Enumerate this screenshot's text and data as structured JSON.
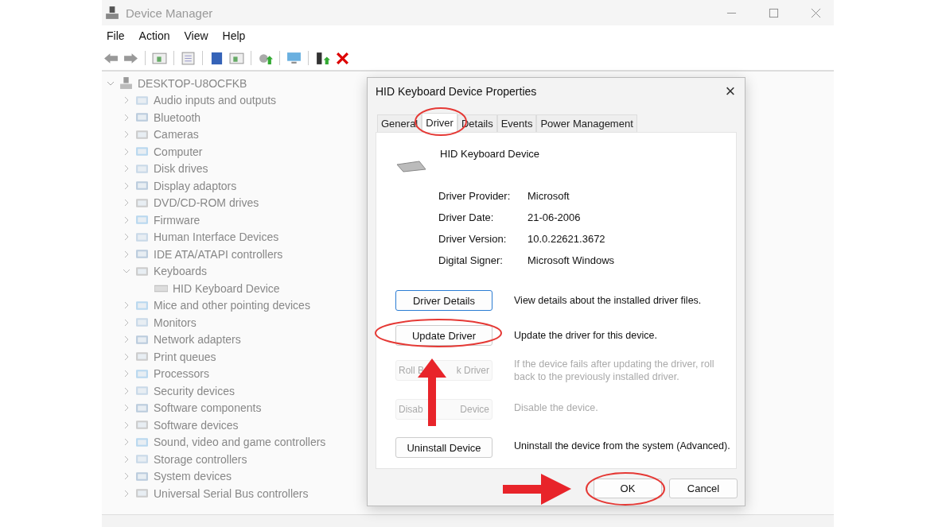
{
  "window": {
    "title": "Device Manager"
  },
  "menu": [
    "File",
    "Action",
    "View",
    "Help"
  ],
  "tree": {
    "root": "DESKTOP-U8OCFKB",
    "expanded": true,
    "children": [
      {
        "label": "Audio inputs and outputs",
        "expanded": false
      },
      {
        "label": "Bluetooth",
        "expanded": false
      },
      {
        "label": "Cameras",
        "expanded": false
      },
      {
        "label": "Computer",
        "expanded": false
      },
      {
        "label": "Disk drives",
        "expanded": false
      },
      {
        "label": "Display adaptors",
        "expanded": false
      },
      {
        "label": "DVD/CD-ROM drives",
        "expanded": false
      },
      {
        "label": "Firmware",
        "expanded": false
      },
      {
        "label": "Human Interface Devices",
        "expanded": false
      },
      {
        "label": "IDE ATA/ATAPI controllers",
        "expanded": false
      },
      {
        "label": "Keyboards",
        "expanded": true,
        "children": [
          {
            "label": "HID Keyboard Device"
          }
        ]
      },
      {
        "label": "Mice and other pointing devices",
        "expanded": false
      },
      {
        "label": "Monitors",
        "expanded": false
      },
      {
        "label": "Network adapters",
        "expanded": false
      },
      {
        "label": "Print queues",
        "expanded": false
      },
      {
        "label": "Processors",
        "expanded": false
      },
      {
        "label": "Security devices",
        "expanded": false
      },
      {
        "label": "Software components",
        "expanded": false
      },
      {
        "label": "Software devices",
        "expanded": false
      },
      {
        "label": "Sound, video and game controllers",
        "expanded": false
      },
      {
        "label": "Storage controllers",
        "expanded": false
      },
      {
        "label": "System devices",
        "expanded": false
      },
      {
        "label": "Universal Serial Bus controllers",
        "expanded": false
      }
    ]
  },
  "dialog": {
    "title": "HID Keyboard Device Properties",
    "close": "×",
    "tabs": [
      {
        "label": "General",
        "selected": false
      },
      {
        "label": "Driver",
        "selected": true
      },
      {
        "label": "Details",
        "selected": false
      },
      {
        "label": "Events",
        "selected": false
      },
      {
        "label": "Power Management",
        "selected": false
      }
    ],
    "device_name": "HID Keyboard Device",
    "properties": [
      {
        "label": "Driver Provider:",
        "value": "Microsoft"
      },
      {
        "label": "Driver Date:",
        "value": "21-06-2006"
      },
      {
        "label": "Driver Version:",
        "value": "10.0.22621.3672"
      },
      {
        "label": "Digital Signer:",
        "value": "Microsoft Windows"
      }
    ],
    "actions": [
      {
        "button": "Driver Details",
        "description": "View details about the installed driver files.",
        "disabled": false
      },
      {
        "button": "Update Driver",
        "description": "Update the driver for this device.",
        "disabled": false
      },
      {
        "button_parts": [
          "Roll B",
          "k Driver"
        ],
        "description": "If the device fails after updating the driver, roll back to the previously installed driver.",
        "disabled": true
      },
      {
        "button_parts": [
          "Disab",
          "Device"
        ],
        "description": "Disable the device.",
        "disabled": true
      },
      {
        "button": "Uninstall Device",
        "description": "Uninstall the device from the system (Advanced).",
        "disabled": false
      }
    ],
    "buttons": [
      "OK",
      "Cancel"
    ]
  }
}
